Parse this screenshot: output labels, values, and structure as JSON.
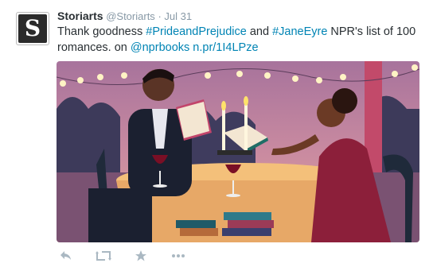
{
  "author": {
    "name": "Storiarts",
    "handle": "@Storiarts",
    "separator": "·",
    "time": "Jul 31",
    "avatar_glyph": "S"
  },
  "tweet_text": {
    "t1": "Thank goodness ",
    "hashtag1": "#PrideandPrejudice",
    "t2": " and ",
    "hashtag2": "#JaneEyre",
    "t3": " NPR's list of 100 romances. on ",
    "mention": "@nprbooks",
    "t4": " ",
    "url": "n.pr/1I4LPze"
  },
  "media": {
    "alt": "illustration-couple-reading-at-candlelit-table"
  },
  "actions": {
    "reply": "reply-icon",
    "retweet": "retweet-icon",
    "favorite": "star-icon",
    "more": "more-icon"
  },
  "colors": {
    "link": "#0084b4",
    "meta": "#8899a6",
    "icon": "#aab8c2",
    "text": "#292f33"
  }
}
